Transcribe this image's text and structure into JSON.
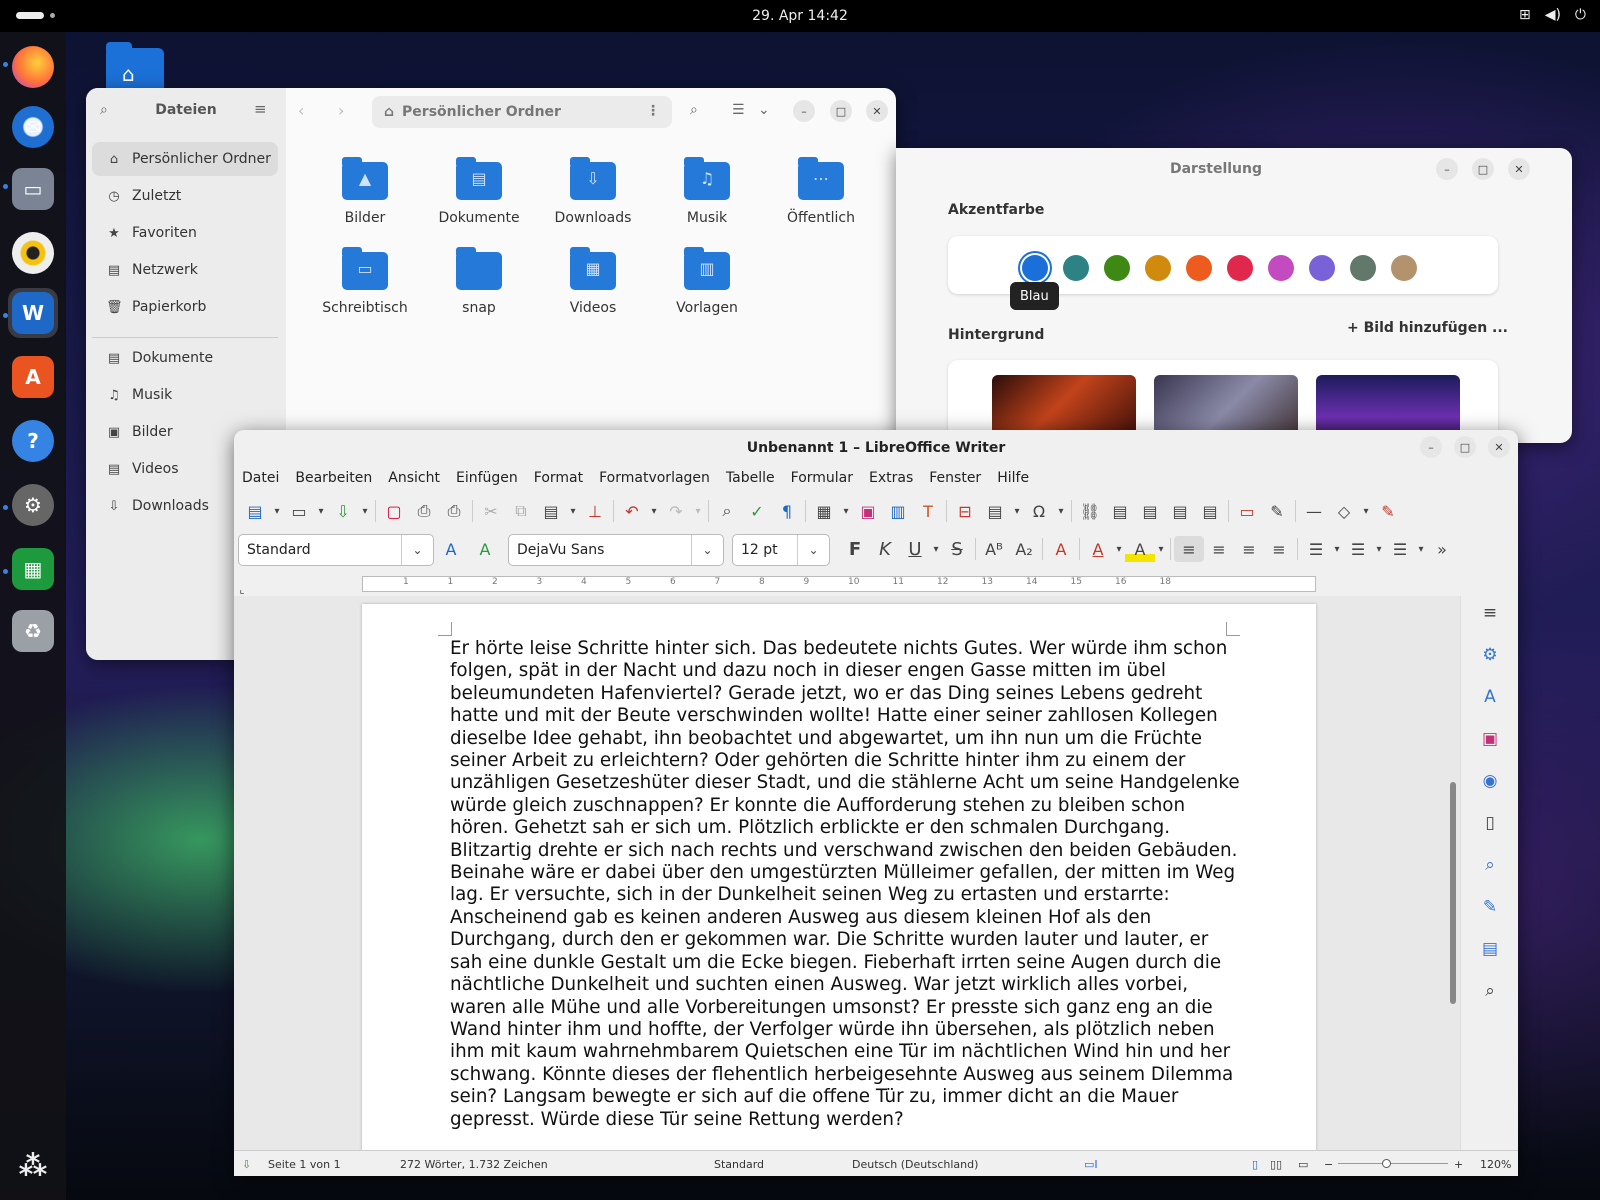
{
  "topbar": {
    "clock": "29. Apr  14:42"
  },
  "dock": {
    "items": [
      "firefox-icon",
      "thunderbird-icon",
      "files-icon",
      "rhythmbox-icon",
      "libreoffice-writer-icon",
      "app-center-icon",
      "help-icon",
      "settings-icon",
      "libreoffice-calc-icon",
      "trash-icon",
      "show-apps-icon"
    ]
  },
  "files": {
    "title": "Dateien",
    "sidebar": [
      {
        "label": "Persönlicher Ordner",
        "icon": "⌂"
      },
      {
        "label": "Zuletzt",
        "icon": "◷"
      },
      {
        "label": "Favoriten",
        "icon": "★"
      },
      {
        "label": "Netzwerk",
        "icon": "▤"
      },
      {
        "label": "Papierkorb",
        "icon": "🗑"
      },
      {
        "label": "Dokumente",
        "icon": "▤"
      },
      {
        "label": "Musik",
        "icon": "♫"
      },
      {
        "label": "Bilder",
        "icon": "▣"
      },
      {
        "label": "Videos",
        "icon": "▤"
      },
      {
        "label": "Downloads",
        "icon": "⇩"
      }
    ],
    "path": "Persönlicher Ordner",
    "folders": [
      {
        "label": "Bilder",
        "icon": "▲"
      },
      {
        "label": "Dokumente",
        "icon": "▤"
      },
      {
        "label": "Downloads",
        "icon": "⇩"
      },
      {
        "label": "Musik",
        "icon": "♫"
      },
      {
        "label": "Öffentlich",
        "icon": "⋯"
      },
      {
        "label": "Schreibtisch",
        "icon": "▭"
      },
      {
        "label": "snap",
        "icon": ""
      },
      {
        "label": "Videos",
        "icon": "▦"
      },
      {
        "label": "Vorlagen",
        "icon": "▥"
      }
    ]
  },
  "appearance": {
    "title": "Darstellung",
    "accent_label": "Akzentfarbe",
    "accent_colors": [
      "#1a6fd9",
      "#2d8283",
      "#3e8914",
      "#d08a0e",
      "#ed5c1e",
      "#e0274c",
      "#c44bbf",
      "#7962d8",
      "#61786a",
      "#b3936d"
    ],
    "tooltip": "Blau",
    "background_label": "Hintergrund",
    "add_image": "Bild hinzufügen ..."
  },
  "writer": {
    "title": "Unbenannt 1 – LibreOffice Writer",
    "menu": [
      "Datei",
      "Bearbeiten",
      "Ansicht",
      "Einfügen",
      "Format",
      "Formatvorlagen",
      "Tabelle",
      "Formular",
      "Extras",
      "Fenster",
      "Hilfe"
    ],
    "style": "Standard",
    "font": "DejaVu Sans",
    "size": "12 pt",
    "ruler": [
      "1",
      "1",
      "2",
      "3",
      "4",
      "5",
      "6",
      "7",
      "8",
      "9",
      "10",
      "11",
      "12",
      "13",
      "14",
      "15",
      "16",
      "18"
    ],
    "body": "Er hörte leise Schritte hinter sich. Das bedeutete nichts Gutes. Wer würde ihm schon folgen, spät in der Nacht und dazu noch in dieser engen Gasse mitten im übel beleumundeten Hafenviertel? Gerade jetzt, wo er das Ding seines Lebens gedreht hatte und mit der Beute verschwinden wollte! Hatte einer seiner zahllosen Kollegen dieselbe Idee gehabt, ihn beobachtet und abgewartet, um ihn nun um die Früchte seiner Arbeit zu erleichtern? Oder gehörten die Schritte hinter ihm zu einem der unzähligen Gesetzeshüter dieser Stadt, und die stählerne Acht um seine Handgelenke würde gleich zuschnappen? Er konnte die Aufforderung stehen zu bleiben schon hören. Gehetzt sah er sich um. Plötzlich erblickte er den schmalen Durchgang. Blitzartig drehte er sich nach rechts und verschwand zwischen den beiden Gebäuden. Beinahe wäre er dabei über den umgestürzten Mülleimer gefallen, der mitten im Weg lag. Er versuchte, sich in der Dunkelheit seinen Weg zu ertasten und erstarrte: Anscheinend gab es keinen anderen Ausweg aus diesem kleinen Hof als den Durchgang, durch den er gekommen war. Die Schritte wurden lauter und lauter, er sah eine dunkle Gestalt um die Ecke biegen. Fieberhaft irrten seine Augen durch die nächtliche Dunkelheit und suchten einen Ausweg. War jetzt wirklich alles vorbei, waren alle Mühe und alle Vorbereitungen umsonst? Er presste sich ganz eng an die Wand hinter ihm und hoffte, der Verfolger würde ihn übersehen, als plötzlich neben ihm mit kaum wahrnehmbarem Quietschen eine Tür im nächtlichen Wind hin und her schwang. Könnte dieses der flehentlich herbeigesehnte Ausweg aus seinem Dilemma sein? Langsam bewegte er sich auf die offene Tür zu, immer dicht an die Mauer gepresst. Würde diese Tür seine Rettung werden?",
    "status": {
      "page": "Seite 1 von 1",
      "words": "272 Wörter, 1.732 Zeichen",
      "style": "Standard",
      "language": "Deutsch (Deutschland)",
      "zoom": "120%"
    }
  }
}
